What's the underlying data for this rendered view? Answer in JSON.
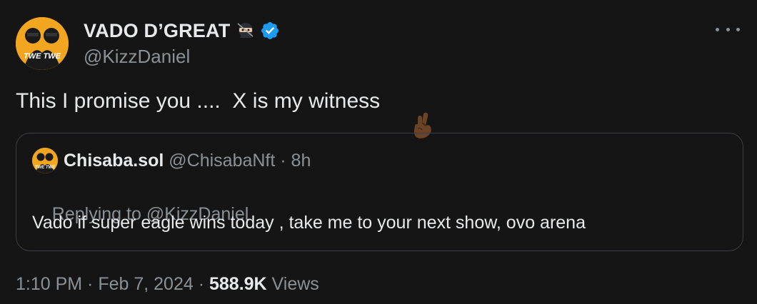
{
  "tweet": {
    "display_name": "VADO D’GREAT",
    "handle": "@KizzDaniel",
    "text": "This I promise you ....  X is my witness",
    "timestamp": "1:10 PM · Feb 7, 2024 · ",
    "views_count": "588.9K",
    "views_label": " Views",
    "avatar_text": "TWE TWE",
    "icons": {
      "ninja": "ninja-emoji",
      "verified": "verified-badge",
      "fingers": "crossed-fingers-emoji",
      "more": "more-dots"
    },
    "colors": {
      "background": "#151515",
      "text": "#e7e9ea",
      "secondary": "#8b9196",
      "verified": "#1d9bf0",
      "border": "#3b3f43"
    }
  },
  "quoted": {
    "name": "Chisaba.sol",
    "handle_time": " @ChisabaNft · 8h",
    "replying_prefix": "Replying to ",
    "replying_mention": "@KizzDaniel",
    "text": "Vado if super eagle wins today , take me to your next show, ovo arena",
    "avatar_text": "TWE TWE"
  }
}
